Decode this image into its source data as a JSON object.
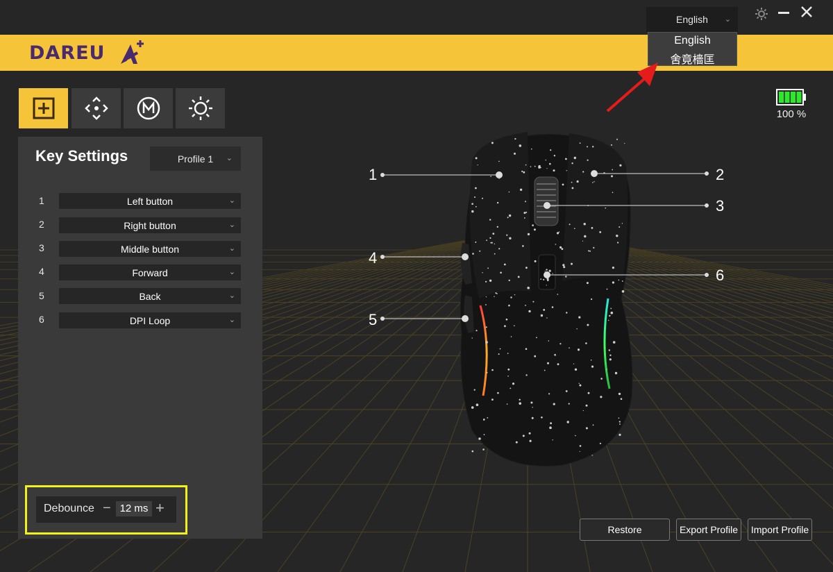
{
  "brand": {
    "name": "DAREU"
  },
  "language": {
    "selected": "English",
    "options": [
      "English",
      "舍竟檣匡"
    ]
  },
  "battery": {
    "level_percent": 100,
    "label": "100 %"
  },
  "tabs": [
    {
      "icon": "key-settings-icon",
      "active": true
    },
    {
      "icon": "dpi-icon",
      "active": false
    },
    {
      "icon": "macro-icon",
      "active": false
    },
    {
      "icon": "lighting-icon",
      "active": false
    }
  ],
  "panel": {
    "title": "Key Settings",
    "profile": "Profile 1",
    "keys": [
      {
        "num": "1",
        "value": "Left button"
      },
      {
        "num": "2",
        "value": "Right button"
      },
      {
        "num": "3",
        "value": "Middle button"
      },
      {
        "num": "4",
        "value": "Forward"
      },
      {
        "num": "5",
        "value": "Back"
      },
      {
        "num": "6",
        "value": "DPI Loop"
      }
    ],
    "debounce": {
      "label": "Debounce",
      "minus": "−",
      "value": "12 ms",
      "plus": "+"
    }
  },
  "callouts": [
    "1",
    "2",
    "3",
    "4",
    "5",
    "6"
  ],
  "buttons": {
    "restore": "Restore",
    "export": "Export Profile",
    "import": "Import Profile"
  },
  "colors": {
    "accent": "#f5c438",
    "brand_purple": "#4a2a6e",
    "highlight": "#f2f217",
    "annotation_arrow": "#e51c1c",
    "battery_green": "#2ee82e"
  }
}
